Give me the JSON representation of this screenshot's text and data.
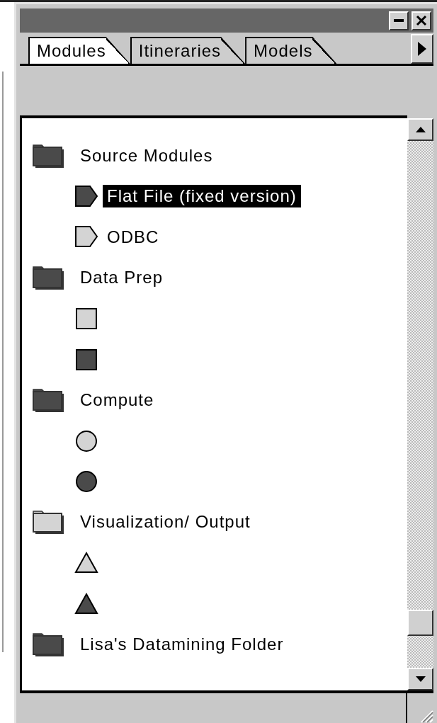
{
  "tabs": [
    {
      "label": "Modules",
      "selected": true
    },
    {
      "label": "Itineraries",
      "selected": false
    },
    {
      "label": "Models",
      "selected": false
    }
  ],
  "tree": [
    {
      "label": "Source Modules",
      "color": "#4a4a4a",
      "selected": false,
      "children": [
        {
          "kind": "arrow",
          "color": "#4a4a4a",
          "label": "Flat File (fixed version)",
          "selected": true
        },
        {
          "kind": "arrow",
          "color": "#d4d4d4",
          "label": "ODBC",
          "selected": false
        }
      ]
    },
    {
      "label": "Data Prep",
      "color": "#4a4a4a",
      "selected": false,
      "children": [
        {
          "kind": "square",
          "color": "#d4d4d4",
          "selected": false
        },
        {
          "kind": "square",
          "color": "#4a4a4a",
          "selected": false
        }
      ]
    },
    {
      "label": "Compute",
      "color": "#4a4a4a",
      "selected": false,
      "children": [
        {
          "kind": "circle",
          "color": "#d4d4d4",
          "selected": false
        },
        {
          "kind": "circle",
          "color": "#4a4a4a",
          "selected": false
        }
      ]
    },
    {
      "label": "Visualization/ Output",
      "color": "#d4d4d4",
      "selected": false,
      "children": [
        {
          "kind": "triangle",
          "color": "#d4d4d4",
          "selected": false
        },
        {
          "kind": "triangle",
          "color": "#4a4a4a",
          "selected": false
        }
      ]
    },
    {
      "label": "Lisa's Datamining Folder",
      "color": "#4a4a4a",
      "selected": false
    }
  ]
}
